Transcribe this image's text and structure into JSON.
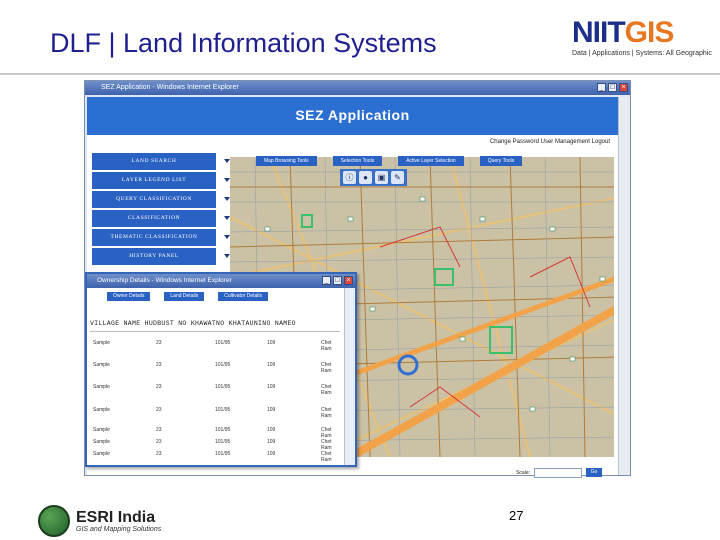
{
  "slide": {
    "title": "DLF | Land Information Systems",
    "page_number": "27"
  },
  "logo_niit": {
    "word_a": "NIIT",
    "word_b": "GIS",
    "tagline": "Data | Applications | Systems: All Geographic"
  },
  "logo_esri": {
    "name": "ESRI India",
    "subtitle": "GIS and Mapping Solutions"
  },
  "browser": {
    "title": "SEZ Application - Windows Internet Explorer",
    "app_title": "SEZ Application",
    "top_links": "Change Password User Management Logout",
    "menu": [
      {
        "label": "LAND SEARCH"
      },
      {
        "label": "LAYER LEGEND LIST"
      },
      {
        "label": "QUERY CLASSIFICATION"
      },
      {
        "label": "CLASSIFICATION"
      },
      {
        "label": "THEMATIC CLASSIFICATION"
      },
      {
        "label": "HISTORY PANEL"
      }
    ],
    "tool_tabs": [
      {
        "label": "Map Browsing Tools"
      },
      {
        "label": "Selection Tools"
      },
      {
        "label": "Active Layer Selection"
      },
      {
        "label": "Query Tools"
      }
    ],
    "scale_label": "Scale:",
    "scale_go": "Go"
  },
  "popup": {
    "title": "Ownership Details - Windows Internet Explorer",
    "tabs": [
      {
        "label": "Owner Details"
      },
      {
        "label": "Land Details"
      },
      {
        "label": "Cultivator Details"
      }
    ],
    "columns": [
      "VILLAGE",
      "NAME",
      "HUDBUST",
      "NO",
      "KHAWATNO",
      "KHATAUNINO",
      "NAMEO"
    ],
    "rows": [
      {
        "village": "Sample",
        "hudbust": "23",
        "khawat": "101/95",
        "khataunino": "109",
        "name": "Chet Ram"
      },
      {
        "village": "Sample",
        "hudbust": "23",
        "khawat": "101/95",
        "khataunino": "109",
        "name": "Chet Ram"
      },
      {
        "village": "Sample",
        "hudbust": "23",
        "khawat": "101/95",
        "khataunino": "109",
        "name": "Chet Ram"
      },
      {
        "village": "Sample",
        "hudbust": "23",
        "khawat": "101/95",
        "khataunino": "109",
        "name": "Chet Ram"
      },
      {
        "village": "Sample",
        "hudbust": "23",
        "khawat": "101/95",
        "khataunino": "109",
        "name": "Chet Ram"
      },
      {
        "village": "Sample",
        "hudbust": "23",
        "khawat": "101/95",
        "khataunino": "109",
        "name": "Chet Ram"
      },
      {
        "village": "Sample",
        "hudbust": "23",
        "khawat": "101/95",
        "khataunino": "109",
        "name": "Chet Ram"
      }
    ]
  }
}
